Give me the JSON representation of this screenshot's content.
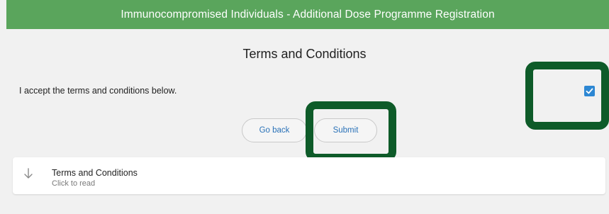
{
  "header": {
    "title": "Immunocompromised Individuals - Additional Dose Programme Registration"
  },
  "page": {
    "title": "Terms and Conditions"
  },
  "terms": {
    "accept_label": "I accept the terms and conditions below.",
    "accept_checked": true
  },
  "actions": {
    "back_label": "Go back",
    "submit_label": "Submit"
  },
  "accordion": {
    "title": "Terms and Conditions",
    "subtitle": "Click to read",
    "icon": "arrow-down-icon"
  },
  "colors": {
    "header_bg": "#5aa55c",
    "checkbox": "#2d87d3",
    "highlight": "#0e5b29",
    "button_text": "#2a72b8"
  }
}
